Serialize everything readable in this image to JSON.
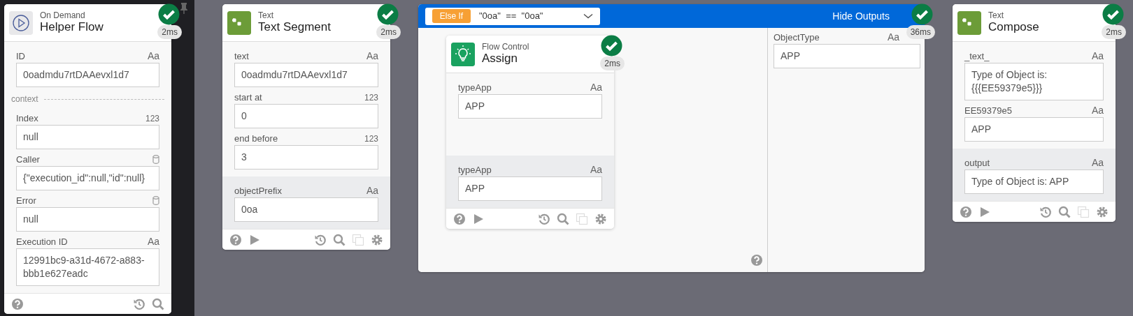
{
  "nodes": [
    {
      "kind": "trigger",
      "category": "On Demand",
      "title": "Helper Flow",
      "duration": "2ms",
      "sections": [
        {
          "kind": "inputs",
          "items": [
            {
              "kind": "value",
              "label": "ID",
              "hint": "Aa",
              "value": "0oadmdu7rtDAAevxl1d7"
            },
            {
              "kind": "divider",
              "label": "context"
            },
            {
              "kind": "value",
              "label": "Index",
              "hint": "123",
              "value": "null"
            },
            {
              "kind": "object",
              "label": "Caller",
              "value": "{\"execution_id\":null,\"id\":null}"
            },
            {
              "kind": "object",
              "label": "Error",
              "value": "null"
            },
            {
              "kind": "value",
              "label": "Execution ID",
              "hint": "Aa",
              "value": "12991bc9-a31d-4672-a883-bbb1e627eadc"
            }
          ]
        }
      ]
    },
    {
      "kind": "text",
      "category": "Text",
      "title": "Text Segment",
      "duration": "2ms",
      "sections": [
        {
          "kind": "inputs",
          "items": [
            {
              "kind": "value",
              "label": "text",
              "hint": "Aa",
              "value": "0oadmdu7rtDAAevxl1d7"
            },
            {
              "kind": "value",
              "label": "start at",
              "hint": "123",
              "value": "0"
            },
            {
              "kind": "value",
              "label": "end before",
              "hint": "123",
              "value": "3"
            }
          ]
        },
        {
          "kind": "outputs",
          "items": [
            {
              "kind": "value",
              "label": "objectPrefix",
              "hint": "Aa",
              "value": "0oa"
            }
          ]
        }
      ]
    },
    {
      "kind": "branch",
      "condition_label": "Else If",
      "condition": "\"0oa\"  ==  \"0oa\"",
      "action": "Hide Outputs",
      "duration": "36ms",
      "children": [
        {
          "kind": "control",
          "category": "Flow Control",
          "title": "Assign",
          "duration": "2ms",
          "sections": [
            {
              "kind": "inputs",
              "items": [
                {
                  "kind": "value",
                  "label": "typeApp",
                  "hint": "Aa",
                  "value": "APP"
                }
              ]
            },
            {
              "kind": "outputs",
              "items": [
                {
                  "kind": "value",
                  "label": "typeApp",
                  "hint": "Aa",
                  "value": "APP"
                }
              ]
            }
          ]
        }
      ],
      "outputs": [
        {
          "kind": "value",
          "label": "ObjectType",
          "hint": "Aa",
          "value": "APP"
        }
      ]
    },
    {
      "kind": "text",
      "category": "Text",
      "title": "Compose",
      "duration": "2ms",
      "sections": [
        {
          "kind": "inputs",
          "items": [
            {
              "kind": "value",
              "label": "_text_",
              "hint": "Aa",
              "value": "Type of Object is: {{{EE59379e5}}}"
            },
            {
              "kind": "value",
              "label": "EE59379e5",
              "hint": "Aa",
              "value": "APP"
            }
          ]
        },
        {
          "kind": "outputs",
          "items": [
            {
              "kind": "value",
              "label": "output",
              "hint": "Aa",
              "value": "Type of Object is: APP"
            }
          ]
        }
      ]
    }
  ]
}
